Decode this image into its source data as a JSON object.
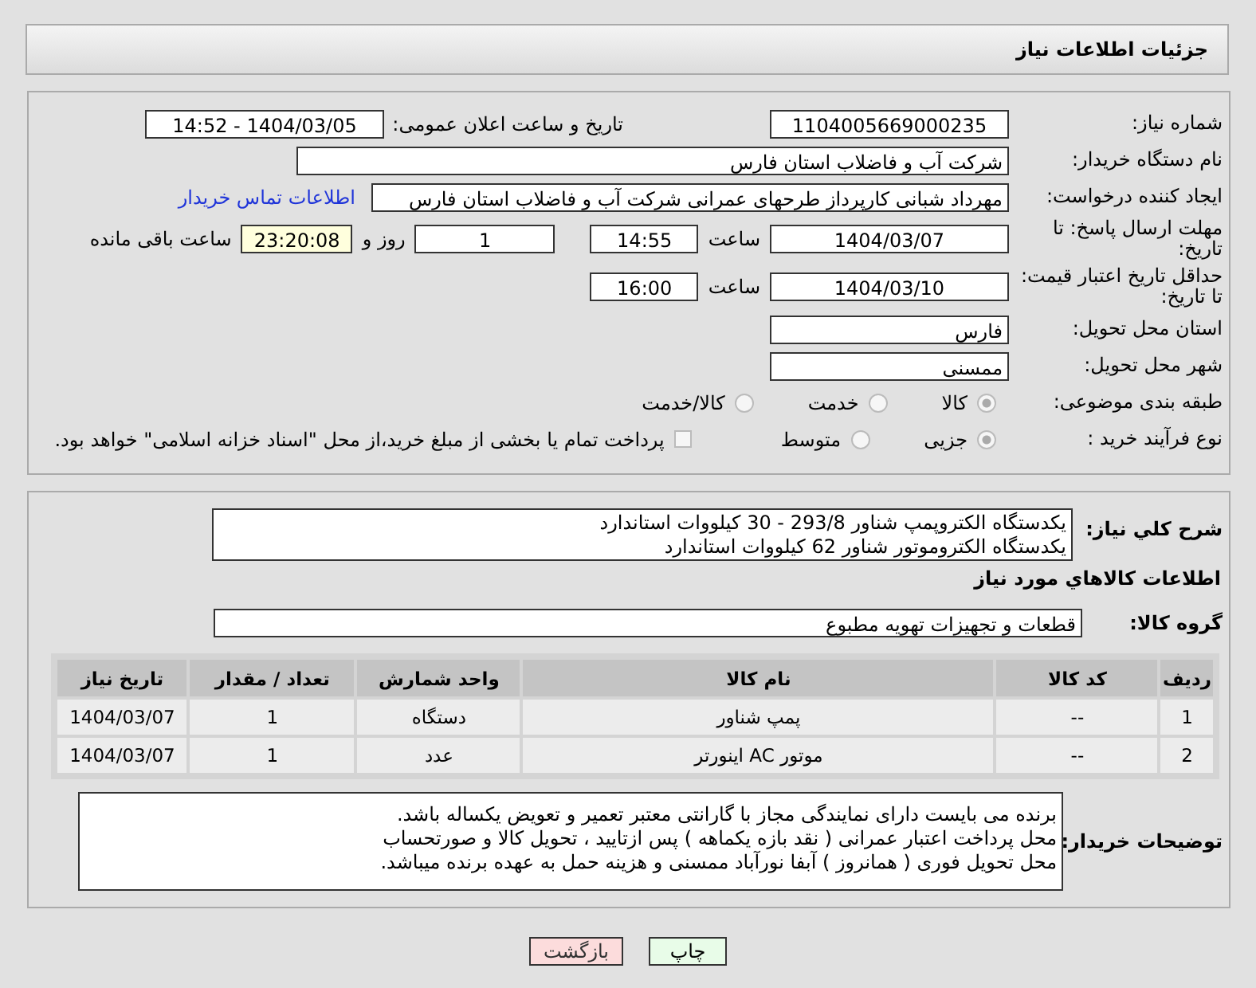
{
  "header": {
    "title": "جزئیات اطلاعات نیاز"
  },
  "need_number": {
    "label": "شماره نیاز:",
    "value": "1104005669000235"
  },
  "announce": {
    "label": "تاریخ و ساعت اعلان عمومی:",
    "value": "1404/03/05 - 14:52"
  },
  "buyer": {
    "label": "نام دستگاه خریدار:",
    "value": "شرکت آب و فاضلاب استان فارس"
  },
  "creator": {
    "label": "ایجاد کننده درخواست:",
    "value": "مهرداد شبانی کارپرداز طرحهای عمرانی  شرکت آب و فاضلاب استان فارس",
    "link": "اطلاعات تماس خریدار"
  },
  "deadline": {
    "label": "مهلت ارسال پاسخ: تا تاریخ:",
    "date": "1404/03/07",
    "time_label": "ساعت",
    "time": "14:55",
    "days": "1",
    "days_label": "روز و",
    "remaining": "23:20:08",
    "remaining_label": "ساعت باقی مانده"
  },
  "validity": {
    "label": "حداقل تاریخ اعتبار قیمت: تا تاریخ:",
    "date": "1404/03/10",
    "time_label": "ساعت",
    "time": "16:00"
  },
  "province": {
    "label": "استان محل تحویل:",
    "value": "فارس"
  },
  "city": {
    "label": "شهر محل تحویل:",
    "value": "ممسنی"
  },
  "category": {
    "label": "طبقه بندی موضوعی:",
    "options": [
      {
        "label": "کالا",
        "selected": true
      },
      {
        "label": "خدمت",
        "selected": false
      },
      {
        "label": "کالا/خدمت",
        "selected": false
      }
    ]
  },
  "process": {
    "label": "نوع فرآیند خرید :",
    "options": [
      {
        "label": "جزیی",
        "selected": true
      },
      {
        "label": "متوسط",
        "selected": false
      }
    ],
    "treasury": {
      "label": "پرداخت تمام یا بخشی از مبلغ خرید،از محل \"اسناد خزانه اسلامی\" خواهد بود.",
      "checked": false
    }
  },
  "description": {
    "label": "شرح کلي نياز:",
    "lines": [
      "یکدستگاه الکتروپمپ شناور  293/8 - 30 کیلووات استاندارد",
      "یکدستگاه الکتروموتور شناور 62 کیلووات استاندارد"
    ]
  },
  "goods_heading": "اطلاعات كالاهاي مورد نياز",
  "goods_group": {
    "label": "گروه کالا:",
    "value": "قطعات و تجهیزات تهویه مطبوع"
  },
  "table": {
    "columns": [
      "ردیف",
      "کد کالا",
      "نام کالا",
      "واحد شمارش",
      "تعداد / مقدار",
      "تاریخ نیاز"
    ],
    "rows": [
      [
        "1",
        "--",
        "پمپ شناور",
        "دستگاه",
        "1",
        "1404/03/07"
      ],
      [
        "2",
        "--",
        "موتور AC اینورتر",
        "عدد",
        "1",
        "1404/03/07"
      ]
    ]
  },
  "notes": {
    "label": "توضیحات خریدار:",
    "lines": [
      "برنده می بایست دارای نمایندگی مجاز با گارانتی معتبر تعمیر و تعویض یکساله باشد.",
      "محل پرداخت اعتبار عمرانی ( نقد بازه یکماهه ) پس ازتایید ، تحویل کالا و صورتحساب",
      "محل تحویل فوری ( همانروز ) آبفا نورآباد ممسنی و هزینه حمل به عهده برنده میباشد."
    ]
  },
  "buttons": [
    {
      "label": "چاپ",
      "kind": "print"
    },
    {
      "label": "بازگشت",
      "kind": "back"
    }
  ]
}
